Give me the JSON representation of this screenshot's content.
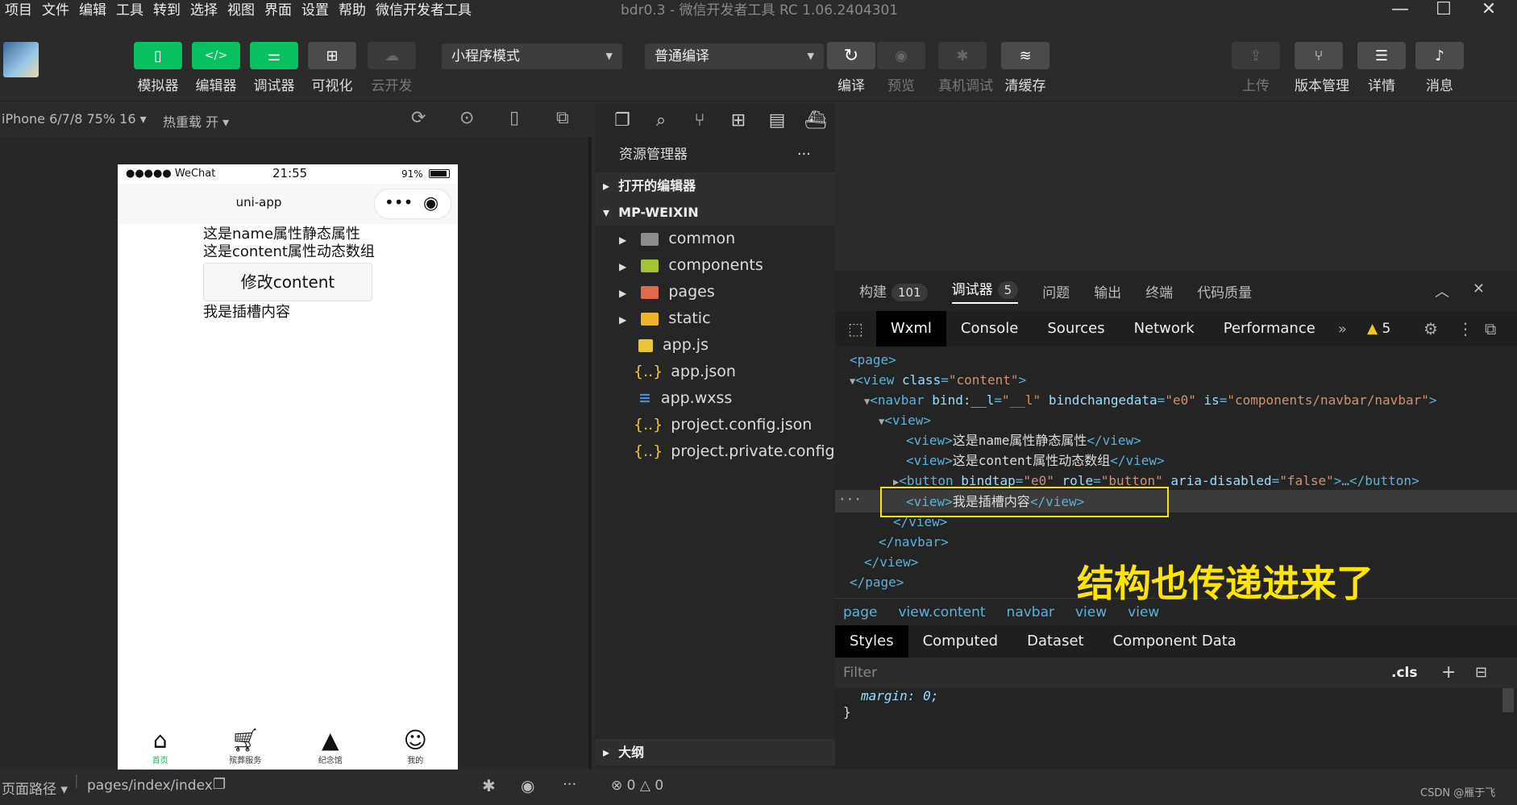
{
  "menu": [
    "项目",
    "文件",
    "编辑",
    "工具",
    "转到",
    "选择",
    "视图",
    "界面",
    "设置",
    "帮助",
    "微信开发者工具"
  ],
  "window_title": "bdr0.3 - 微信开发者工具 RC 1.06.2404301",
  "toolbar": {
    "simulator": "模拟器",
    "editor": "编辑器",
    "debugger": "调试器",
    "visual": "可视化",
    "cloud": "云开发",
    "mode_select": "小程序模式",
    "compile_select": "普通编译",
    "compile": "编译",
    "preview": "预览",
    "real_debug": "真机调试",
    "clear_cache": "清缓存",
    "upload": "上传",
    "version": "版本管理",
    "details": "详情",
    "messages": "消息"
  },
  "simulator": {
    "device": "iPhone 6/7/8 75% 16",
    "hot_reload": "热重载 开",
    "status": {
      "carrier": "●●●●● WeChat",
      "time": "21:55",
      "battery": "91%"
    },
    "nav_title": "uni-app",
    "content": {
      "line1": "这是name属性静态属性",
      "line2": "这是content属性动态数组",
      "button": "修改content",
      "slot": "我是插槽内容"
    },
    "tabs": [
      "首页",
      "殡葬服务",
      "纪念馆",
      "我的"
    ]
  },
  "explorer": {
    "title": "资源管理器",
    "open_editors": "打开的编辑器",
    "project": "MP-WEIXIN",
    "folders": [
      "common",
      "components",
      "pages",
      "static"
    ],
    "files": [
      "app.js",
      "app.json",
      "app.wxss",
      "project.config.json",
      "project.private.config.js..."
    ],
    "outline": "大纲"
  },
  "devtools": {
    "tabs": {
      "build": "构建",
      "build_count": "101",
      "debugger": "调试器",
      "debugger_count": "5",
      "issues": "问题",
      "output": "输出",
      "terminal": "终端",
      "quality": "代码质量"
    },
    "panels": [
      "Wxml",
      "Console",
      "Sources",
      "Network",
      "Performance"
    ],
    "warnings": "5",
    "wxml": {
      "l1": "<page>",
      "l2_tag": "<view ",
      "l2_attr": "class",
      "l2_val": "\"content\"",
      "l2_end": ">",
      "l3_tag": "<navbar ",
      "l3_a1": "bind:__l",
      "l3_v1": "\"__l\"",
      "l3_a2": "bindchangedata",
      "l3_v2": "\"e0\"",
      "l3_a3": "is",
      "l3_v3": "\"components/navbar/navbar\"",
      "l3_end": ">",
      "l4": "<view>",
      "l5_open": "<view>",
      "l5_text": "这是name属性静态属性",
      "l5_close": "</view>",
      "l6_open": "<view>",
      "l6_text": "这是content属性动态数组",
      "l6_close": "</view>",
      "l7_tag": "<button ",
      "l7_a1": "bindtap",
      "l7_v1": "\"e0\"",
      "l7_a2": "role",
      "l7_v2": "\"button\"",
      "l7_a3": "aria-disabled",
      "l7_v3": "\"false\"",
      "l7_end": ">…</button>",
      "l8_open": "<view>",
      "l8_text": "我是插槽内容",
      "l8_close": "</view>",
      "l9": "</view>",
      "l10": "</navbar>",
      "l11": "</view>",
      "l12": "</page>"
    },
    "annotation": "结构也传递进来了",
    "breadcrumb": [
      "page",
      "view.content",
      "navbar",
      "view",
      "view"
    ],
    "style_tabs": [
      "Styles",
      "Computed",
      "Dataset",
      "Component Data"
    ],
    "filter_placeholder": "Filter",
    "cls": ".cls",
    "css_line1": "margin: 0;",
    "css_line2": "}"
  },
  "statusbar": {
    "page_path_label": "页面路径",
    "page_path": "pages/index/index",
    "errors": "0",
    "warnings": "0",
    "watermark": "CSDN @雁于飞"
  }
}
